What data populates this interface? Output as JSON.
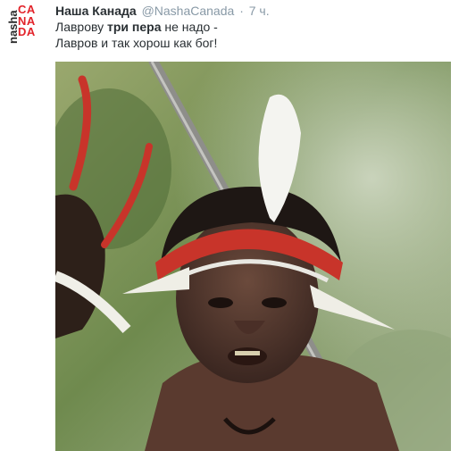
{
  "account": {
    "name": "Наша Канада",
    "handle": "@NashaCanada",
    "separator": "·",
    "time": "7 ч."
  },
  "avatar": {
    "word_small": "nasha",
    "word_large_lines": [
      "CA",
      "NA",
      "DA"
    ],
    "colors": {
      "text": "#2b2b2b",
      "accent": "#e2232a"
    }
  },
  "tweet": {
    "line1_before": "Лаврову ",
    "line1_bold": "три пера",
    "line1_after": " не надо -",
    "line2": "Лавров и так хорош как бог!"
  },
  "media": {
    "description_icon": "photo-image"
  },
  "colors": {
    "name": "#292f33",
    "meta": "#8899a6",
    "feather_red": "#c8342a",
    "feather_white": "#f4f4f0"
  }
}
